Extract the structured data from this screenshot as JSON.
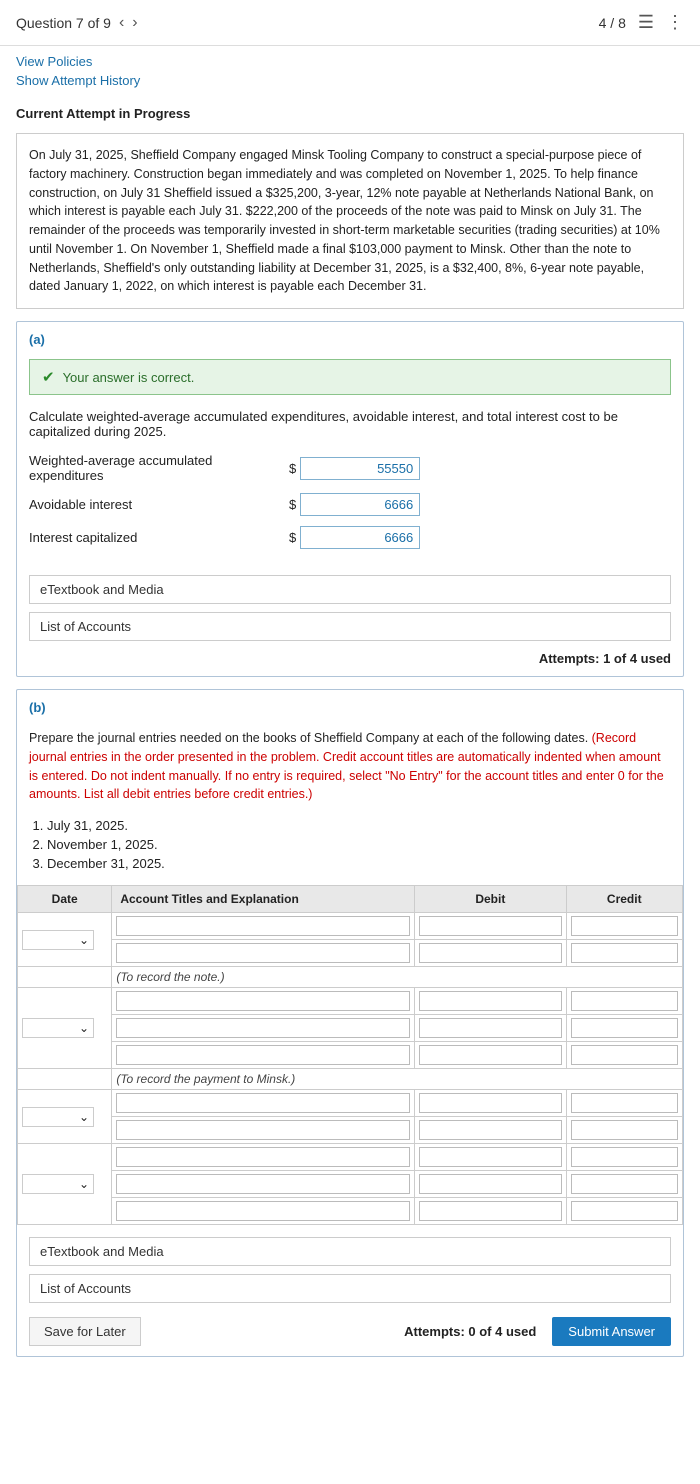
{
  "header": {
    "question_label": "Question 7 of 9",
    "page_info": "4 / 8"
  },
  "top_links": {
    "view_policies": "View Policies",
    "show_attempt": "Show Attempt History"
  },
  "attempt_label": "Current Attempt in Progress",
  "problem_text": "On July 31, 2025, Sheffield Company engaged Minsk Tooling Company to construct a special-purpose piece of factory machinery. Construction began immediately and was completed on November 1, 2025. To help finance construction, on July 31 Sheffield issued a $325,200, 3-year, 12% note payable at Netherlands National Bank, on which interest is payable each July 31. $222,200 of the proceeds of the note was paid to Minsk on July 31. The remainder of the proceeds was temporarily invested in short-term marketable securities (trading securities) at 10% until November 1. On November 1, Sheffield made a final $103,000 payment to Minsk. Other than the note to Netherlands, Sheffield's only outstanding liability at December 31, 2025, is a $32,400, 8%, 6-year note payable, dated January 1, 2022, on which interest is payable each December 31.",
  "section_a": {
    "label": "(a)",
    "correct_message": "Your answer is correct.",
    "instruction": "Calculate weighted-average accumulated expenditures, avoidable interest, and total interest cost to be capitalized during 2025.",
    "fields": [
      {
        "label": "Weighted-average accumulated expenditures",
        "value": "55550"
      },
      {
        "label": "Avoidable interest",
        "value": "6666"
      },
      {
        "label": "Interest capitalized",
        "value": "6666"
      }
    ],
    "dollar_sign": "$",
    "buttons": [
      "eTextbook and Media",
      "List of Accounts"
    ],
    "attempts": "Attempts: 1 of 4 used"
  },
  "section_b": {
    "label": "(b)",
    "instruction_normal": "Prepare the journal entries needed on the books of Sheffield Company at each of the following dates.",
    "instruction_red": "(Record journal entries in the order presented in the problem. Credit account titles are automatically indented when amount is entered. Do not indent manually. If no entry is required, select \"No Entry\" for the account titles and enter 0 for the amounts. List all debit entries before credit entries.)",
    "dates": [
      {
        "num": "1.",
        "date": "July 31, 2025."
      },
      {
        "num": "2.",
        "date": "November 1, 2025."
      },
      {
        "num": "3.",
        "date": "December 31, 2025."
      }
    ],
    "table_headers": [
      "Date",
      "Account Titles and Explanation",
      "Debit",
      "Credit"
    ],
    "notes": [
      {
        "text": "(To record the note.)",
        "after_row": 1
      },
      {
        "text": "(To record the payment to Minsk.)",
        "after_row": 2
      }
    ],
    "buttons": [
      "eTextbook and Media",
      "List of Accounts"
    ],
    "attempts": "Attempts: 0 of 4 used",
    "save_label": "Save for Later",
    "submit_label": "Submit Answer"
  }
}
